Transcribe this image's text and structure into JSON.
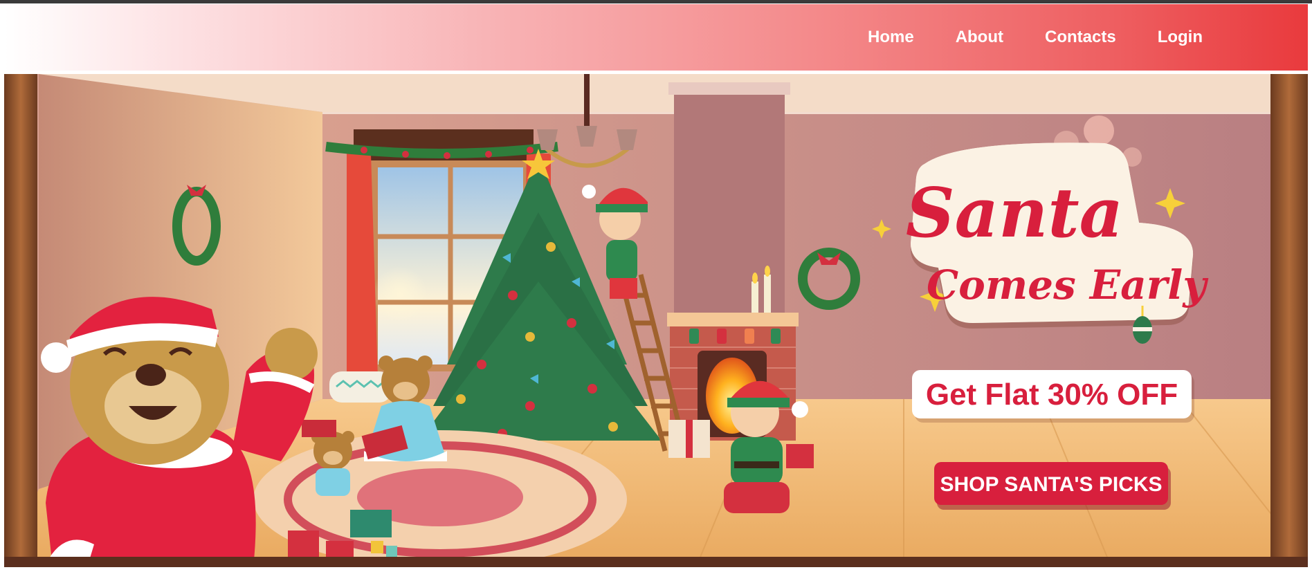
{
  "nav": {
    "items": [
      {
        "label": "Home"
      },
      {
        "label": "About"
      },
      {
        "label": "Contacts"
      },
      {
        "label": "Login"
      }
    ]
  },
  "banner": {
    "headline_line1": "Santa",
    "headline_line2": "Comes Early",
    "offer": "Get Flat 30% OFF",
    "cta": "SHOP SANTA'S PICKS",
    "colors": {
      "headline": "#d81f3d",
      "cta_bg": "#d81f3d",
      "nav_gradient_end": "#e93a3d",
      "wall": "#c98d83",
      "floor": "#efb66c",
      "tree": "#2e7b4b"
    }
  }
}
